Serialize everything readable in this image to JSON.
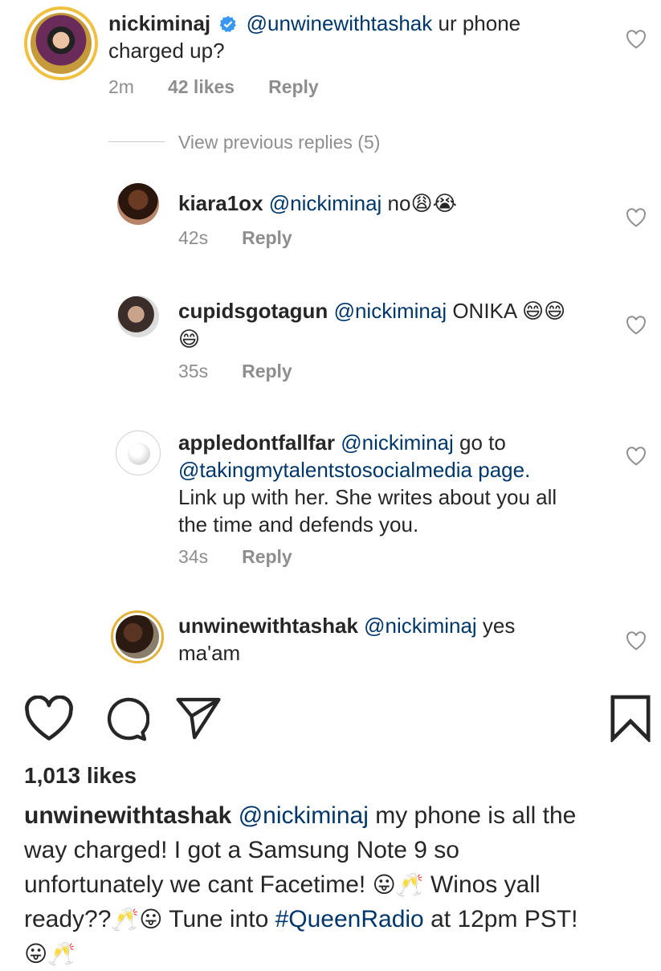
{
  "main_comment": {
    "username": "nickiminaj",
    "mention": "@unwinewithtashak",
    "text_line1_after": " ur phone",
    "text_line2": "charged up?",
    "time": "2m",
    "likes": "42 likes",
    "reply": "Reply"
  },
  "view_previous": "View previous replies (5)",
  "replies": [
    {
      "username": "kiara1ox",
      "mention": "@nickiminaj",
      "text": " no",
      "emojis": "😩😭",
      "time": "42s",
      "reply": "Reply"
    },
    {
      "username": "cupidsgotagun",
      "mention": "@nickiminaj",
      "text": " ONIKA ",
      "emojis": "😄😄",
      "emojis2": "😄",
      "time": "35s",
      "reply": "Reply"
    },
    {
      "username": "appledontfallfar",
      "mention": "@nickiminaj",
      "text": " go to",
      "line2": "@takingmytalentstosocialmedia page.",
      "line3": "Link up with her. She writes about you all",
      "line4": "the time and defends you.",
      "time": "34s",
      "reply": "Reply"
    },
    {
      "username": "unwinewithtashak",
      "mention": "@nickiminaj",
      "text": " yes",
      "line2": "ma'am"
    }
  ],
  "actions": {
    "like_icon": "heart-icon",
    "comment_icon": "comment-icon",
    "share_icon": "share-icon",
    "save_icon": "bookmark-icon"
  },
  "post": {
    "likes": "1,013 likes",
    "username": "unwinewithtashak",
    "mention": "@nickiminaj",
    "caption_l1": " my phone is all the",
    "caption_l2": "way charged! I got a Samsung Note 9 so",
    "caption_l3a": "unfortunately we cant Facetime! ",
    "caption_l3e": "😛🥂",
    "caption_l3b": " Winos yall",
    "caption_l4a": "ready??",
    "caption_l4e": "🥂😛",
    "caption_l4b": " Tune into ",
    "hashtag": "#QueenRadio",
    "caption_l4c": " at 12pm PST!",
    "caption_l5e": "😛🥂"
  },
  "colors": {
    "text": "#262626",
    "muted": "#8e8e8e",
    "link": "#00376b",
    "verified": "#3897f0"
  }
}
